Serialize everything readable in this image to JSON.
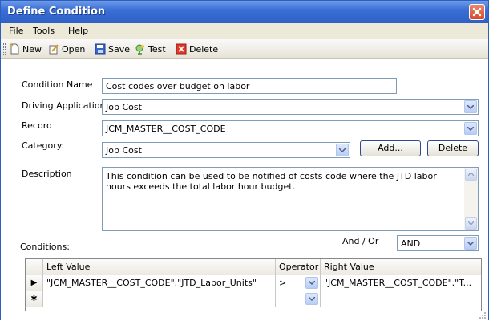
{
  "window": {
    "title": "Define Condition"
  },
  "menu": {
    "items": [
      "File",
      "Tools",
      "Help"
    ]
  },
  "toolbar": {
    "new": "New",
    "open": "Open",
    "save": "Save",
    "test": "Test",
    "delete": "Delete"
  },
  "form": {
    "condition_name": {
      "label": "Condition Name",
      "value": "Cost codes over budget on labor"
    },
    "driving_application": {
      "label": "Driving Application",
      "value": "Job Cost"
    },
    "record": {
      "label": "Record",
      "value": "JCM_MASTER__COST_CODE"
    },
    "category": {
      "label": "Category:",
      "value": "Job Cost",
      "add_button": "Add...",
      "delete_button": "Delete"
    },
    "description": {
      "label": "Description",
      "value": "This condition can be used to be notified of costs code where the JTD labor hours exceeds the total labor hour budget."
    }
  },
  "conditions": {
    "label": "Conditions:",
    "and_or_label": "And / Or",
    "and_or_value": "AND",
    "columns": [
      "Left Value",
      "Operator",
      "Right Value"
    ],
    "rows": [
      {
        "marker": "▶",
        "left": "\"JCM_MASTER__COST_CODE\".\"JTD_Labor_Units\"",
        "operator": ">",
        "right": "\"JCM_MASTER__COST_CODE\".\"T..."
      },
      {
        "marker": "✱",
        "left": "",
        "operator": "",
        "right": ""
      }
    ]
  },
  "colors": {
    "titlebar": "#3a6fd6",
    "close": "#d34a2a",
    "border": "#7f9db9"
  }
}
